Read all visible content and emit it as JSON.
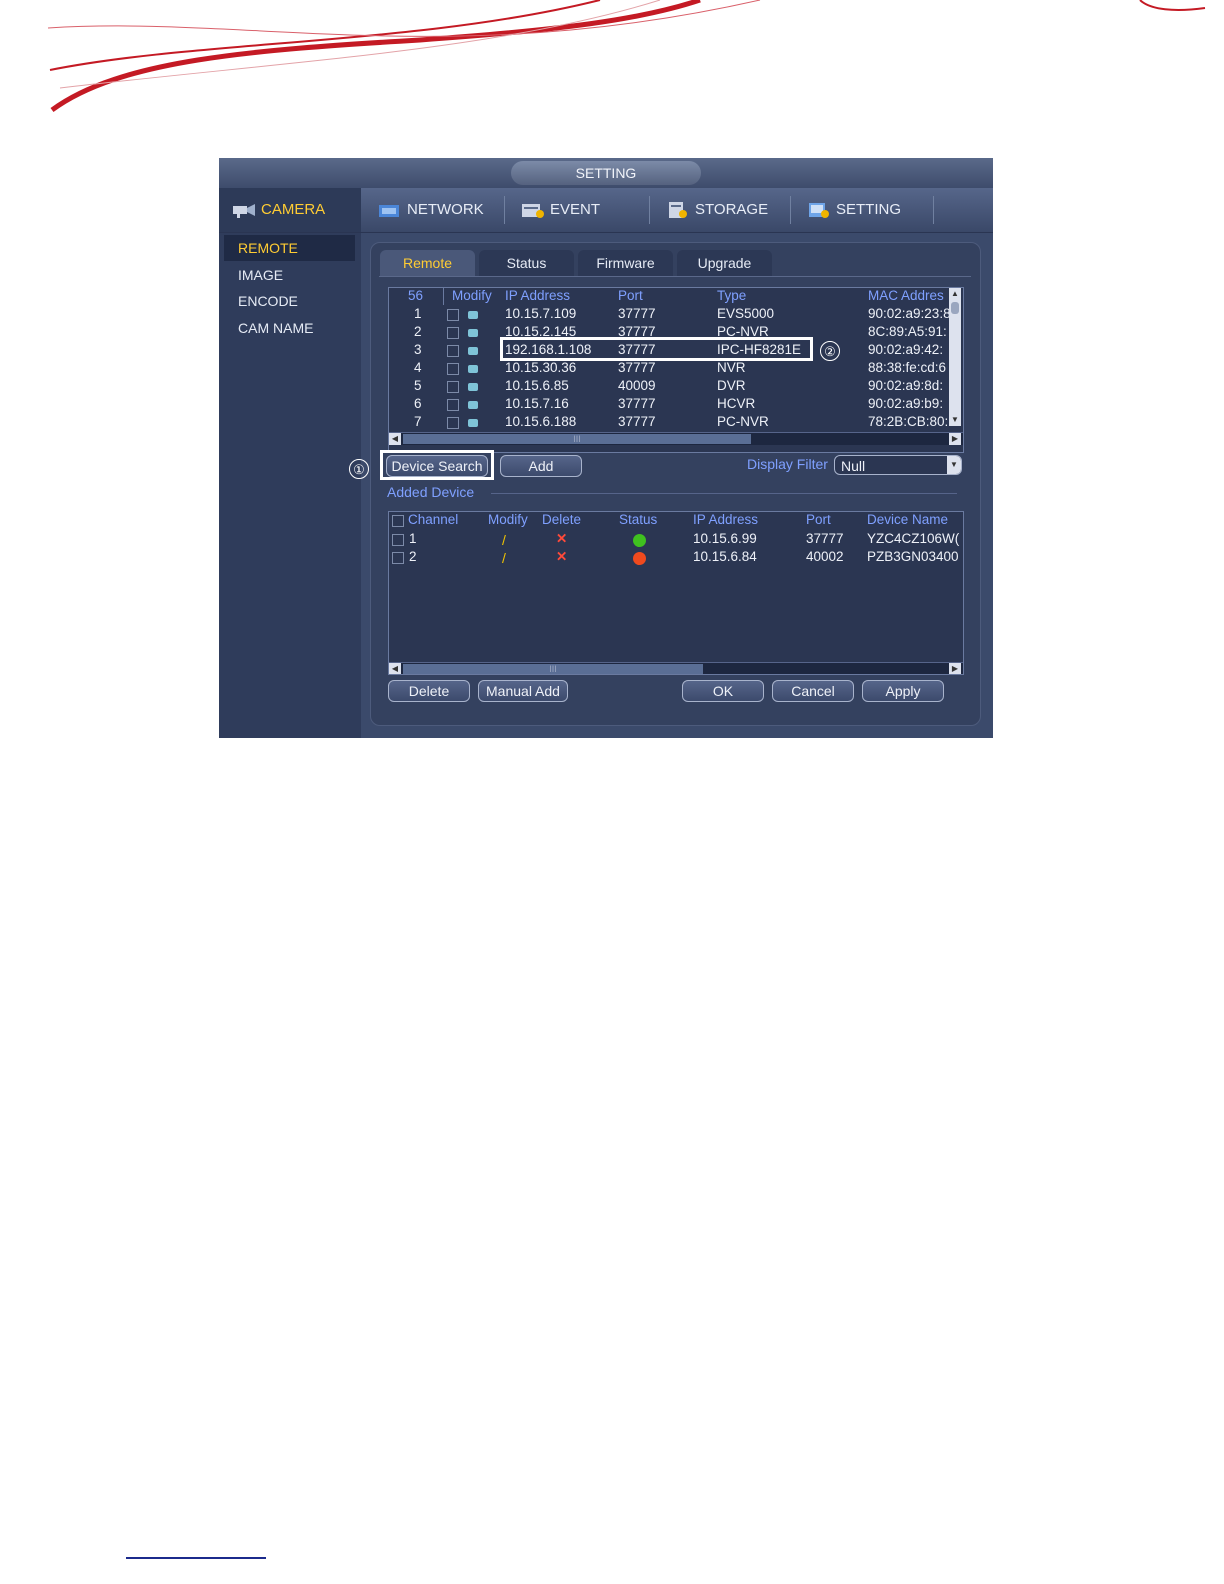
{
  "window": {
    "title": "SETTING"
  },
  "topnav": [
    {
      "label": "CAMERA",
      "icon": "camera-icon"
    },
    {
      "label": "NETWORK",
      "icon": "network-icon"
    },
    {
      "label": "EVENT",
      "icon": "event-icon"
    },
    {
      "label": "STORAGE",
      "icon": "storage-icon"
    },
    {
      "label": "SETTING",
      "icon": "setting-icon"
    }
  ],
  "sidebar": [
    {
      "label": "REMOTE"
    },
    {
      "label": "IMAGE"
    },
    {
      "label": "ENCODE"
    },
    {
      "label": "CAM NAME"
    }
  ],
  "tabs": [
    {
      "label": "Remote"
    },
    {
      "label": "Status"
    },
    {
      "label": "Firmware"
    },
    {
      "label": "Upgrade"
    }
  ],
  "search_table": {
    "headers": {
      "count": "56",
      "modify": "Modify",
      "ip": "IP Address",
      "port": "Port",
      "type": "Type",
      "mac": "MAC Addres"
    },
    "rows": [
      {
        "no": "1",
        "ip": "10.15.7.109",
        "port": "37777",
        "type": "EVS5000",
        "mac": "90:02:a9:23:8"
      },
      {
        "no": "2",
        "ip": "10.15.2.145",
        "port": "37777",
        "type": "PC-NVR",
        "mac": "8C:89:A5:91:"
      },
      {
        "no": "3",
        "ip": "192.168.1.108",
        "port": "37777",
        "type": "IPC-HF8281E",
        "mac": "90:02:a9:42:"
      },
      {
        "no": "4",
        "ip": "10.15.30.36",
        "port": "37777",
        "type": "NVR",
        "mac": "88:38:fe:cd:6"
      },
      {
        "no": "5",
        "ip": "10.15.6.85",
        "port": "40009",
        "type": "DVR",
        "mac": "90:02:a9:8d:"
      },
      {
        "no": "6",
        "ip": "10.15.7.16",
        "port": "37777",
        "type": "HCVR",
        "mac": "90:02:a9:b9:"
      },
      {
        "no": "7",
        "ip": "10.15.6.188",
        "port": "37777",
        "type": "PC-NVR",
        "mac": "78:2B:CB:80:"
      }
    ],
    "scroll_thumb_label": "III"
  },
  "controls": {
    "device_search": "Device Search",
    "add": "Add",
    "display_filter_label": "Display Filter",
    "display_filter_value": "Null",
    "callout_1": "①",
    "callout_2": "②"
  },
  "added_device": {
    "section_label": "Added Device",
    "headers": {
      "channel": "Channel",
      "modify": "Modify",
      "delete": "Delete",
      "status": "Status",
      "ip": "IP Address",
      "port": "Port",
      "name": "Device Name"
    },
    "rows": [
      {
        "channel": "1",
        "status": "online",
        "status_color": "#3fc11f",
        "ip": "10.15.6.99",
        "port": "37777",
        "name": "YZC4CZ106W("
      },
      {
        "channel": "2",
        "status": "offline",
        "status_color": "#f04a1e",
        "ip": "10.15.6.84",
        "port": "40002",
        "name": "PZB3GN03400"
      }
    ],
    "scroll_thumb_label": "III"
  },
  "footer_buttons": {
    "delete": "Delete",
    "manual_add": "Manual Add",
    "ok": "OK",
    "cancel": "Cancel",
    "apply": "Apply"
  },
  "colors": {
    "brand_red": "#c41a24",
    "accent_yellow": "#ffcc33",
    "header_blue": "#7fa0ff"
  }
}
